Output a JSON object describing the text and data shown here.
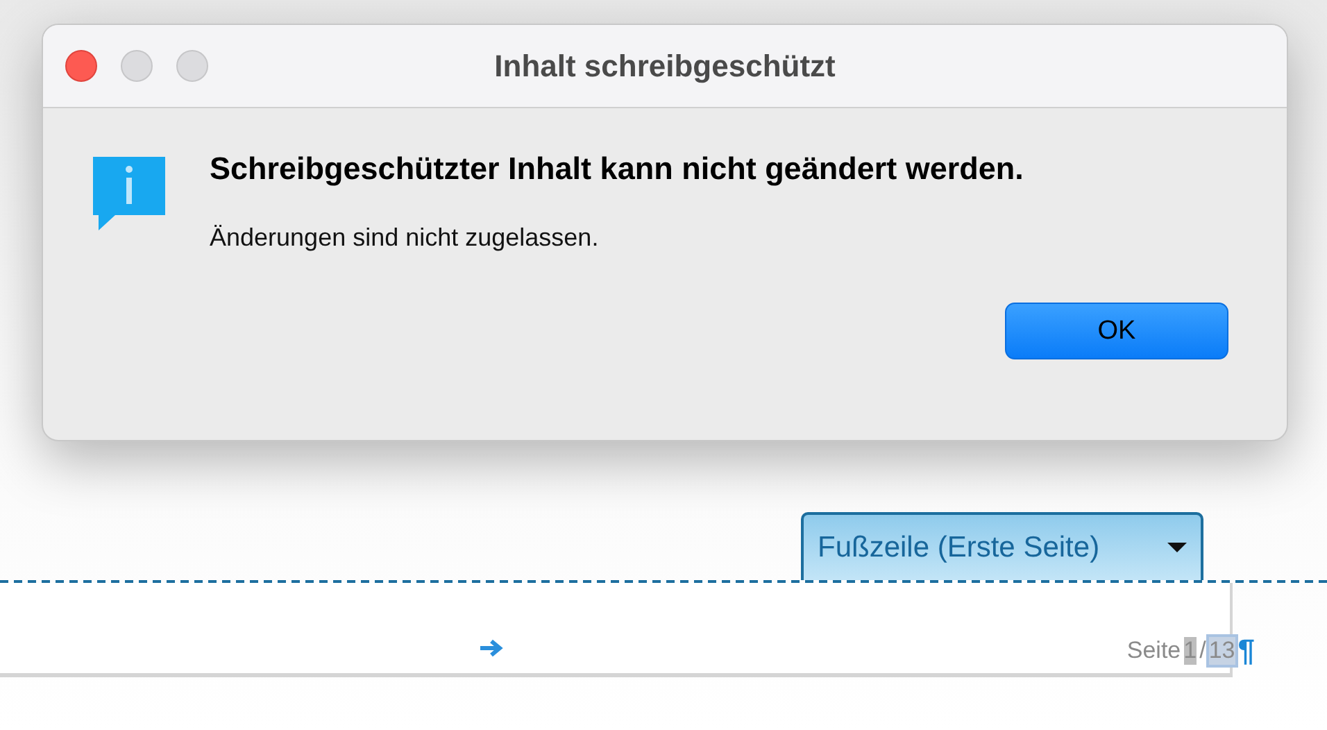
{
  "dialog": {
    "title": "Inhalt schreibgeschützt",
    "heading": "Schreibgeschützter Inhalt kann nicht geändert werden.",
    "message": "Änderungen sind nicht zugelassen.",
    "buttons": [
      {
        "label": "OK",
        "default": true
      }
    ]
  },
  "document": {
    "footer_tab": {
      "label": "Fußzeile (Erste Seite)"
    },
    "page_field": {
      "prefix": "Seite",
      "current": "1",
      "separator": "/",
      "total": "13"
    },
    "paragraph_mark": "¶"
  }
}
